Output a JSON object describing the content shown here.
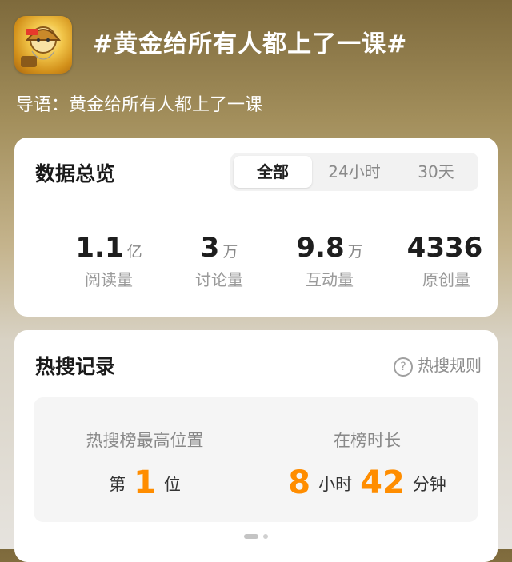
{
  "header": {
    "app_icon": "gold-miner-icon",
    "topic_title": "#黄金给所有人都上了一课#",
    "intro": "导语：黄金给所有人都上了一课"
  },
  "overview": {
    "title": "数据总览",
    "tabs": [
      {
        "label": "全部",
        "active": true
      },
      {
        "label": "24小时",
        "active": false
      },
      {
        "label": "30天",
        "active": false
      }
    ],
    "stats": [
      {
        "value": "1.1",
        "unit": "亿",
        "label": "阅读量"
      },
      {
        "value": "3",
        "unit": "万",
        "label": "讨论量"
      },
      {
        "value": "9.8",
        "unit": "万",
        "label": "互动量"
      },
      {
        "value": "4336",
        "unit": "",
        "label": "原创量"
      }
    ]
  },
  "hot_search": {
    "title": "热搜记录",
    "rules_label": "热搜规则",
    "rules_icon": "question-circle-icon",
    "best_position": {
      "label": "热搜榜最高位置",
      "prefix": "第",
      "value": "1",
      "suffix": "位"
    },
    "duration": {
      "label": "在榜时长",
      "hours": "8",
      "hours_unit": "小时",
      "minutes": "42",
      "minutes_unit": "分钟"
    }
  },
  "colors": {
    "accent": "#ff8d00"
  }
}
